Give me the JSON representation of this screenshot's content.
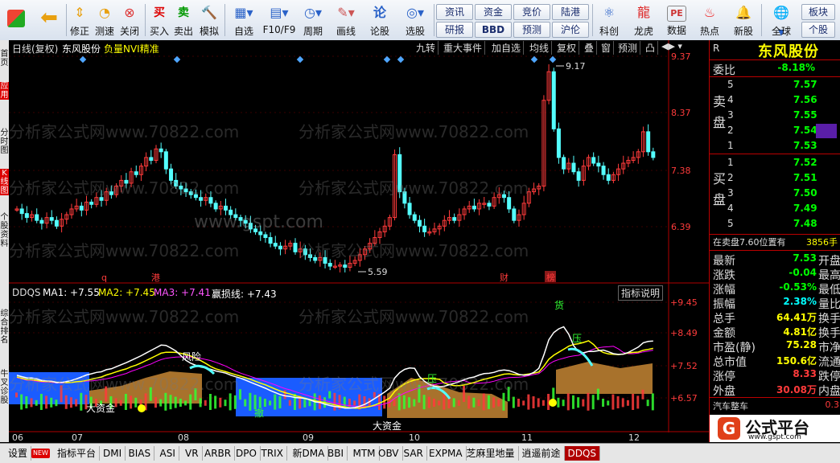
{
  "toolbar": {
    "buttons": [
      {
        "icon": "menu-grid",
        "label": ""
      },
      {
        "icon": "back-arrow",
        "label": ""
      },
      {
        "icon": "fix-icon",
        "label": "修正"
      },
      {
        "icon": "measure-icon",
        "label": "测速"
      },
      {
        "icon": "close-icon",
        "label": "关闭"
      },
      {
        "icon": "buy-icon",
        "label": "买入"
      },
      {
        "icon": "sell-icon",
        "label": "卖出"
      },
      {
        "icon": "hammer-icon",
        "label": "模拟"
      },
      {
        "icon": "watchlist-icon",
        "label": "自选"
      },
      {
        "icon": "f10-icon",
        "label": "F10/F9"
      },
      {
        "icon": "period-icon",
        "label": "周期"
      },
      {
        "icon": "draw-icon",
        "label": "画线"
      },
      {
        "icon": "discuss-icon",
        "label": "论股"
      },
      {
        "icon": "select-icon",
        "label": "选股"
      }
    ],
    "quick": [
      [
        "资讯",
        "资金",
        "竞价",
        "陆港"
      ],
      [
        "研报",
        "BBD",
        "预测",
        "沪伦"
      ]
    ],
    "right_buttons": [
      {
        "icon": "science-icon",
        "label": "科创"
      },
      {
        "icon": "dragon-icon",
        "label": "龙虎"
      },
      {
        "icon": "pe-icon",
        "label": "数据"
      },
      {
        "icon": "hot-icon",
        "label": "热点"
      },
      {
        "icon": "new-icon",
        "label": "新股"
      },
      {
        "icon": "globe-icon",
        "label": "全球"
      }
    ],
    "block_buttons": [
      "板块",
      "个股"
    ]
  },
  "left_rail": [
    "首页",
    "应用",
    "分时图",
    "K线图",
    "个股资料",
    "综合排名",
    "牛叉诊股"
  ],
  "chart": {
    "header": {
      "period": "日线(复权)",
      "stock": "东风股份",
      "indicator": "负量NVI精准"
    },
    "top_menu": [
      "九转",
      "重大事件",
      "加自选",
      "均线",
      "复权",
      "叠",
      "窗",
      "预测",
      "凸"
    ],
    "price_axis": [
      "9.37",
      "8.37",
      "7.38",
      "6.39"
    ],
    "high_label": "9.17",
    "low_label": "5.59",
    "event_tags": [
      "q",
      "港",
      "财",
      "榜"
    ],
    "sub_header": {
      "name": "DDQS",
      "ma1": "MA1: +7.55",
      "ma2": "MA2: +7.45",
      "ma3": "MA3: +7.41",
      "line": "赢损线: +7.43",
      "explain": "指标说明"
    },
    "sub_axis": [
      "+9.45",
      "+8.49",
      "+7.52",
      "+6.57"
    ],
    "sub_tags": [
      "风险",
      "大资金",
      "大资金",
      "货",
      "压",
      "压",
      "撤"
    ],
    "dates": [
      "06",
      "07",
      "08",
      "09",
      "10",
      "11",
      "12"
    ],
    "watermark_top": "www.gspt.com",
    "watermark_repeat": "分析家公式网www.70822.com"
  },
  "right_panel": {
    "title": "东风股份",
    "code_tag": "R",
    "weibi_label": "委比",
    "weibi_value": "-8.18%",
    "sell_label": "卖盘",
    "buy_label": "买盘",
    "sells": [
      [
        "5",
        "7.57"
      ],
      [
        "4",
        "7.56"
      ],
      [
        "3",
        "7.55"
      ],
      [
        "2",
        "7.54"
      ],
      [
        "1",
        "7.53"
      ]
    ],
    "buys": [
      [
        "1",
        "7.52"
      ],
      [
        "2",
        "7.51"
      ],
      [
        "3",
        "7.50"
      ],
      [
        "4",
        "7.49"
      ],
      [
        "5",
        "7.48"
      ]
    ],
    "sell_note": "在卖盘7.60位置有",
    "sell_note_vol": "3856手",
    "stats": [
      [
        "最新",
        "7.53",
        "开盘"
      ],
      [
        "涨跌",
        "-0.04",
        "最高"
      ],
      [
        "涨幅",
        "-0.53%",
        "最低"
      ],
      [
        "振幅",
        "2.38%",
        "量比"
      ],
      [
        "总手",
        "64.41万",
        "换手"
      ],
      [
        "金额",
        "4.81亿",
        "换手"
      ],
      [
        "市盈(静)",
        "75.28",
        "市净"
      ],
      [
        "总市值",
        "150.6亿",
        "流通"
      ],
      [
        "涨停",
        "8.33",
        "跌停"
      ],
      [
        "外盘",
        "30.08万",
        "内盘"
      ]
    ],
    "sector": "汽车整车",
    "sector_val": "0.3",
    "logo_text": "公式平台",
    "logo_url": "www.gspt.com"
  },
  "bottom_tabs": [
    "设置",
    "指标平台",
    "DMI",
    "BIAS",
    "ASI",
    "VR",
    "ARBR",
    "DPO",
    "TRIX",
    "新DMA",
    "BBI",
    "MTM",
    "OBV",
    "SAR",
    "EXPMA",
    "芝麻里地量",
    "逍遥前途",
    "DDQS"
  ],
  "bottom_new_badge": "NEW",
  "colors": {
    "up": "#ff3b3b",
    "down": "#54ffff",
    "ma_white": "#ffffff",
    "ma_yellow": "#ffff00",
    "ma_purple": "#ff00ff",
    "blue_zone": "#1a5cff",
    "brown_zone": "#a8722c"
  }
}
